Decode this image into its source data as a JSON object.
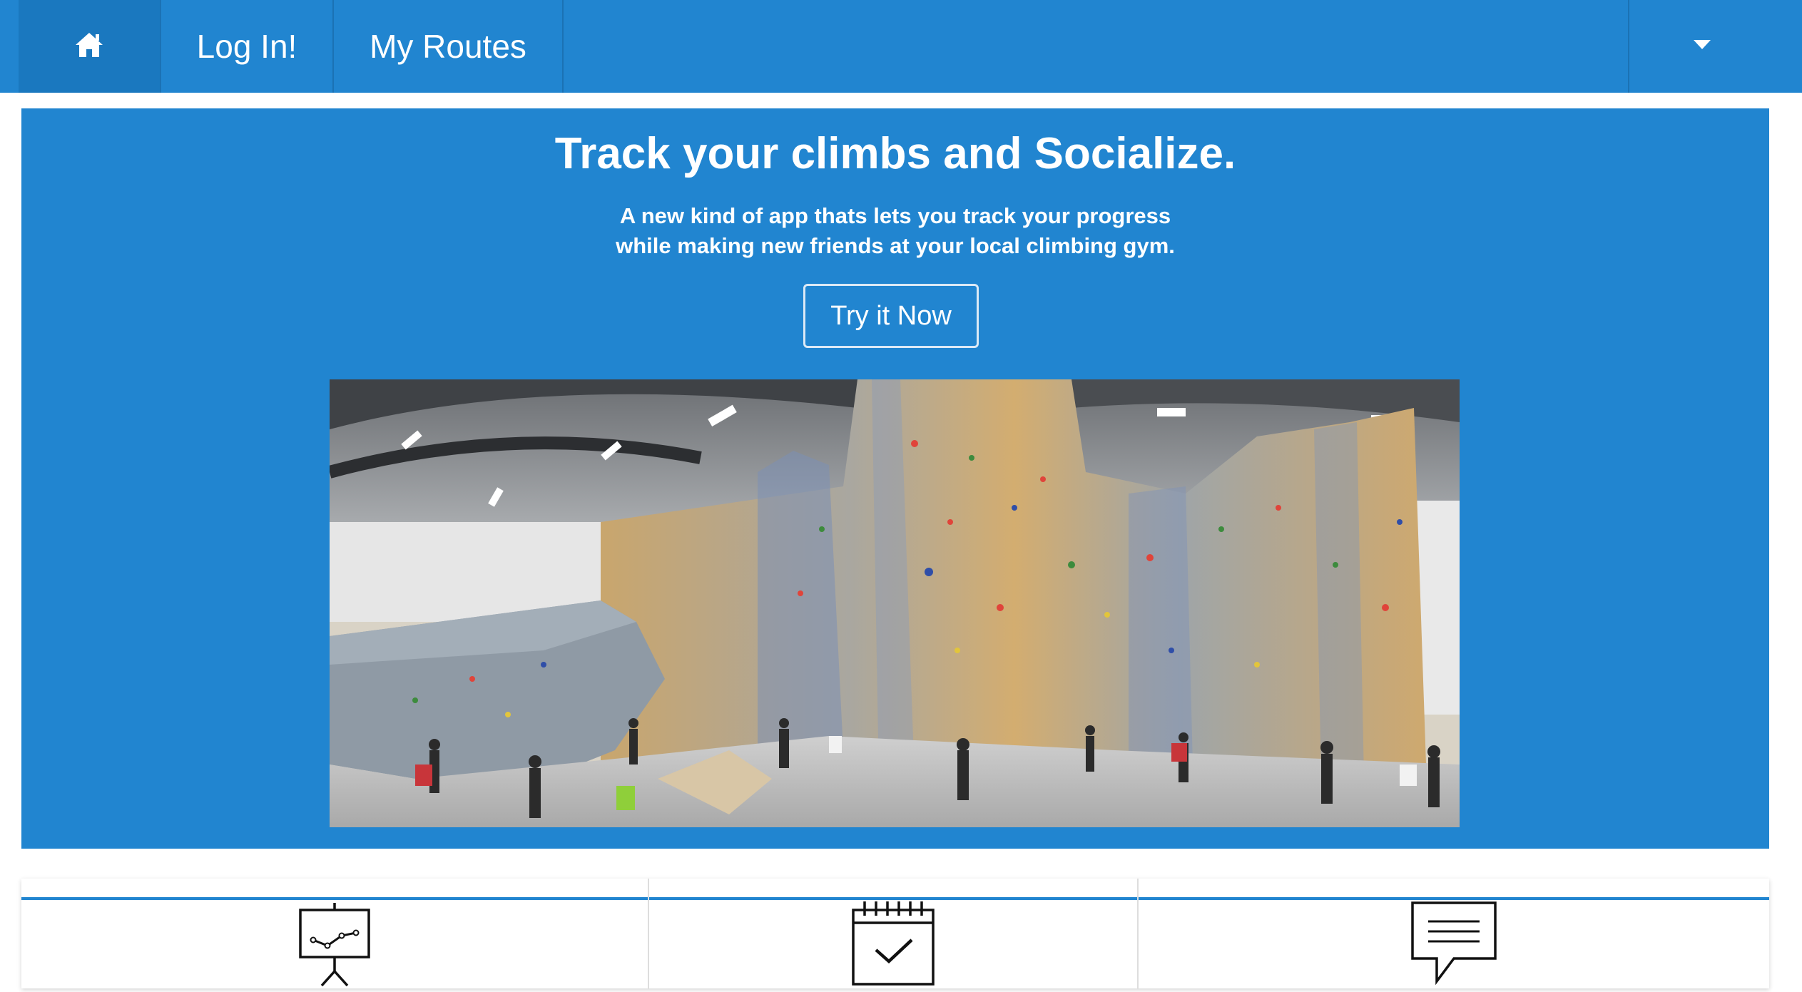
{
  "nav": {
    "home_icon": "home-icon",
    "login_label": "Log In!",
    "routes_label": "My Routes",
    "dropdown_icon": "caret-down-icon"
  },
  "hero": {
    "title": "Track your climbs and Socialize.",
    "subtitle_line1": "A new kind of app thats lets you track your progress",
    "subtitle_line2": "while making new friends at your local climbing gym.",
    "cta_label": "Try it Now",
    "photo": "climbing-gym-panorama"
  },
  "features": {
    "icons": [
      "presentation-chart-icon",
      "calendar-check-icon",
      "chat-bubble-icon"
    ]
  },
  "colors": {
    "primary": "#2185d0",
    "nav_home_bg": "#1a78bf",
    "white": "#ffffff"
  }
}
